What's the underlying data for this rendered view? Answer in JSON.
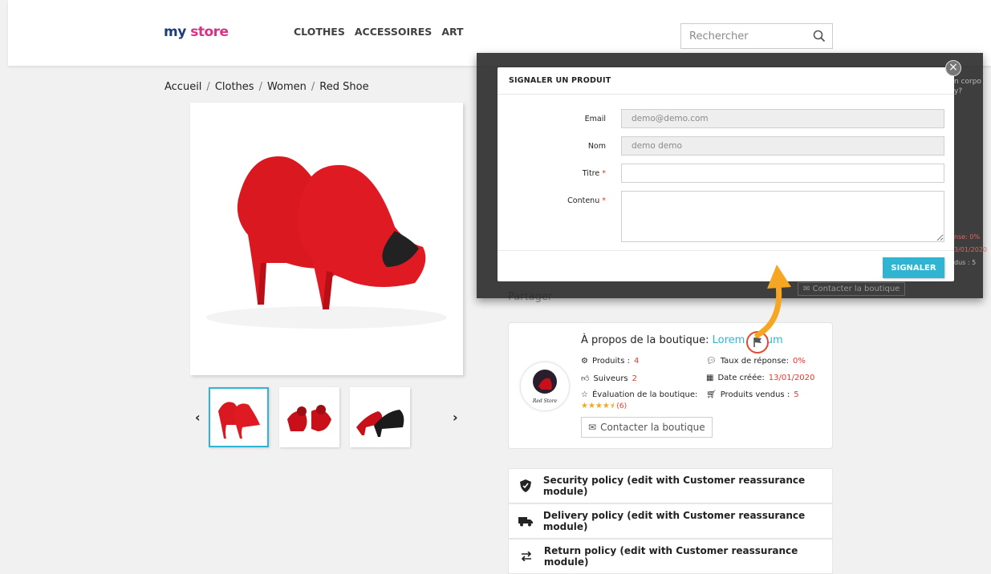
{
  "brand": {
    "logo_my": "my",
    "logo_store": "store"
  },
  "nav": [
    "CLOTHES",
    "ACCESSOIRES",
    "ART"
  ],
  "search": {
    "placeholder": "Rechercher"
  },
  "breadcrumb": [
    "Accueil",
    "Clothes",
    "Women",
    "Red Shoe"
  ],
  "share_label": "Partager",
  "shop": {
    "title_prefix": "À propos de la boutique: ",
    "name": "Lorem lipsum",
    "avatar_text": "Red Store",
    "products_label": "Produits :",
    "products_value": "4",
    "followers_label": "Suiveurs",
    "followers_value": "2",
    "rating_label": "Évaluation de la boutique:",
    "rating_count": "(6)",
    "rating_stars": 4.5,
    "response_label": "Taux de réponse:",
    "response_value": "0%",
    "created_label": "Date créée:",
    "created_value": "13/01/2020",
    "sold_label": "Produits vendus :",
    "sold_value": "5",
    "contact_label": "Contacter la boutique"
  },
  "policies": [
    {
      "label": "Security policy (edit with Customer reassurance module)",
      "icon": "shield-icon"
    },
    {
      "label": "Delivery policy (edit with Customer reassurance module)",
      "icon": "truck-icon"
    },
    {
      "label": "Return policy (edit with Customer reassurance module)",
      "icon": "exchange-icon"
    }
  ],
  "behind_fragments": {
    "text1": "n corpo",
    "text2": "y?",
    "text3": "nse: 0%",
    "text4": "3/01/2020",
    "text5": "dus : 5",
    "contact": "Contacter la boutique"
  },
  "modal": {
    "title": "SIGNALER UN PRODUIT",
    "email_label": "Email",
    "email_value": "demo@demo.com",
    "name_label": "Nom",
    "name_value": "demo demo",
    "title_label": "Titre",
    "content_label": "Contenu",
    "required_mark": "*",
    "submit_label": "SIGNALER",
    "close_label": "×"
  },
  "colors": {
    "accent": "#2fb5d2",
    "highlight": "#e9372a",
    "arrow": "#f5a623"
  }
}
